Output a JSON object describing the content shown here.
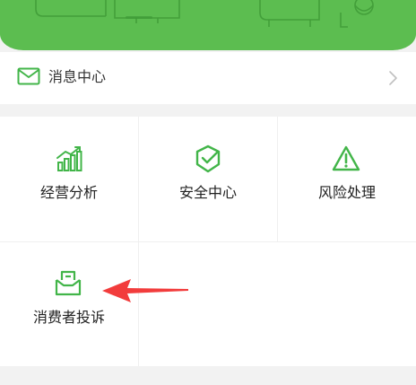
{
  "header": {
    "background_color": "#5cbd50"
  },
  "message_center": {
    "label": "消息中心",
    "icon": "mail-icon",
    "chevron_icon": "chevron-right-icon"
  },
  "grid": {
    "items": [
      {
        "label": "经营分析",
        "icon": "bar-chart-icon"
      },
      {
        "label": "安全中心",
        "icon": "shield-check-icon"
      },
      {
        "label": "风险处理",
        "icon": "warning-triangle-icon"
      },
      {
        "label": "消费者投诉",
        "icon": "complaint-envelope-icon"
      }
    ],
    "accent_color": "#42b549"
  },
  "annotation": {
    "arrow_color": "#f23c3c",
    "arrow_icon": "red-arrow-annotation"
  }
}
